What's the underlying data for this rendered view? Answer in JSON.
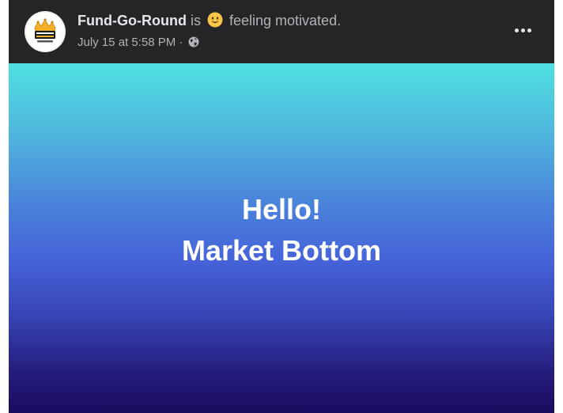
{
  "post": {
    "page_name": "Fund-Go-Round",
    "status_is": "is",
    "feeling_text": "feeling motivated.",
    "timestamp": "July 15 at 5:58 PM",
    "separator": "·",
    "audience_icon": "globe-icon",
    "feeling_icon": "smiling-face-emoji",
    "more_icon": "more-options-icon",
    "avatar_icon": "crown-logo",
    "image": {
      "line1": "Hello!",
      "line2": "Market Bottom"
    }
  },
  "colors": {
    "card_background": "#242526",
    "primary_text": "#e4e6eb",
    "secondary_text": "#b0b3b8",
    "gradient_top": "#4ee0e0",
    "gradient_middle": "#4664da",
    "gradient_bottom": "#1a0b5e",
    "emoji_yellow": "#f7c64a"
  }
}
